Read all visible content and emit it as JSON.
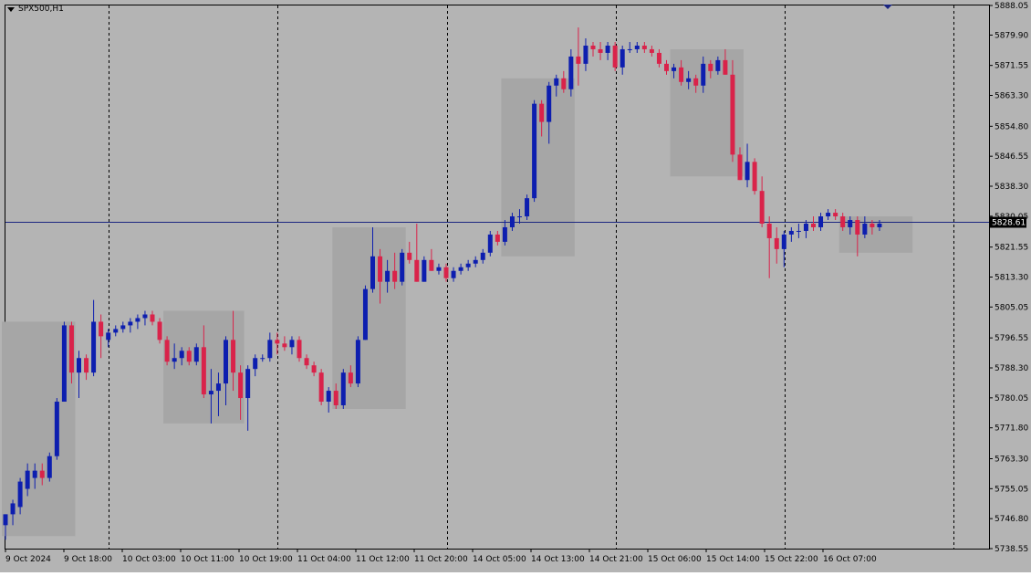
{
  "header": {
    "symbol_timeframe": "SPX500,H1"
  },
  "price_label": "5828.61",
  "colors": {
    "background": "#b4b4b4",
    "zone": "#a6a6a6",
    "bull": "#0d1eaf",
    "bear": "#d9234a",
    "grid": "#000000",
    "price_line": "#1a2580"
  },
  "chart_data": {
    "type": "candlestick",
    "ylim": [
      5738.55,
      5888.05
    ],
    "y_ticks": [
      "5888.05",
      "5879.90",
      "5871.55",
      "5863.30",
      "5854.80",
      "5846.55",
      "5838.30",
      "5830.05",
      "5821.55",
      "5813.30",
      "5805.05",
      "5796.55",
      "5788.30",
      "5780.05",
      "5771.80",
      "5763.30",
      "5755.05",
      "5746.80",
      "5738.55"
    ],
    "x_labels": [
      "9 Oct 2024",
      "9 Oct 18:00",
      "10 Oct 03:00",
      "10 Oct 11:00",
      "10 Oct 19:00",
      "11 Oct 04:00",
      "11 Oct 12:00",
      "11 Oct 20:00",
      "14 Oct 05:00",
      "14 Oct 13:00",
      "14 Oct 21:00",
      "15 Oct 06:00",
      "15 Oct 14:00",
      "15 Oct 22:00",
      "16 Oct 07:00"
    ],
    "current_price": 5828.61,
    "candles": [
      {
        "o": 5745,
        "h": 5748,
        "l": 5741,
        "c": 5748
      },
      {
        "o": 5748,
        "h": 5752,
        "l": 5745,
        "c": 5751
      },
      {
        "o": 5750,
        "h": 5758,
        "l": 5748,
        "c": 5757
      },
      {
        "o": 5755,
        "h": 5762,
        "l": 5753,
        "c": 5760
      },
      {
        "o": 5758,
        "h": 5762,
        "l": 5755,
        "c": 5760
      },
      {
        "o": 5760,
        "h": 5762,
        "l": 5756,
        "c": 5758
      },
      {
        "o": 5758,
        "h": 5765,
        "l": 5757,
        "c": 5764
      },
      {
        "o": 5764,
        "h": 5780,
        "l": 5763,
        "c": 5779
      },
      {
        "o": 5779,
        "h": 5801,
        "l": 5779,
        "c": 5800
      },
      {
        "o": 5800,
        "h": 5801,
        "l": 5784,
        "c": 5787
      },
      {
        "o": 5787,
        "h": 5793,
        "l": 5780,
        "c": 5791
      },
      {
        "o": 5791,
        "h": 5792,
        "l": 5785,
        "c": 5787
      },
      {
        "o": 5787,
        "h": 5807,
        "l": 5786,
        "c": 5801
      },
      {
        "o": 5801,
        "h": 5803,
        "l": 5791,
        "c": 5797
      },
      {
        "o": 5796,
        "h": 5799,
        "l": 5794,
        "c": 5798
      },
      {
        "o": 5798,
        "h": 5800,
        "l": 5797,
        "c": 5799
      },
      {
        "o": 5799,
        "h": 5801,
        "l": 5798,
        "c": 5800
      },
      {
        "o": 5800,
        "h": 5802,
        "l": 5798,
        "c": 5801
      },
      {
        "o": 5801,
        "h": 5803,
        "l": 5799,
        "c": 5802
      },
      {
        "o": 5802,
        "h": 5804,
        "l": 5800,
        "c": 5803
      },
      {
        "o": 5803,
        "h": 5804,
        "l": 5800,
        "c": 5801
      },
      {
        "o": 5801,
        "h": 5802,
        "l": 5795,
        "c": 5796
      },
      {
        "o": 5796,
        "h": 5797,
        "l": 5789,
        "c": 5790
      },
      {
        "o": 5790,
        "h": 5795,
        "l": 5788,
        "c": 5791
      },
      {
        "o": 5791,
        "h": 5794,
        "l": 5789,
        "c": 5793
      },
      {
        "o": 5793,
        "h": 5794,
        "l": 5789,
        "c": 5790
      },
      {
        "o": 5790,
        "h": 5795,
        "l": 5789,
        "c": 5794
      },
      {
        "o": 5794,
        "h": 5800,
        "l": 5780,
        "c": 5781
      },
      {
        "o": 5781,
        "h": 5788,
        "l": 5773,
        "c": 5782
      },
      {
        "o": 5782,
        "h": 5787,
        "l": 5775,
        "c": 5784
      },
      {
        "o": 5784,
        "h": 5797,
        "l": 5778,
        "c": 5796
      },
      {
        "o": 5796,
        "h": 5804,
        "l": 5782,
        "c": 5787
      },
      {
        "o": 5787,
        "h": 5789,
        "l": 5774,
        "c": 5780
      },
      {
        "o": 5780,
        "h": 5789,
        "l": 5771,
        "c": 5788
      },
      {
        "o": 5788,
        "h": 5792,
        "l": 5786,
        "c": 5791
      },
      {
        "o": 5791,
        "h": 5792,
        "l": 5790,
        "c": 5791
      },
      {
        "o": 5791,
        "h": 5798,
        "l": 5790,
        "c": 5796
      },
      {
        "o": 5796,
        "h": 5798,
        "l": 5792,
        "c": 5795
      },
      {
        "o": 5795,
        "h": 5797,
        "l": 5793,
        "c": 5794
      },
      {
        "o": 5794,
        "h": 5797,
        "l": 5792,
        "c": 5796
      },
      {
        "o": 5796,
        "h": 5797,
        "l": 5790,
        "c": 5791
      },
      {
        "o": 5791,
        "h": 5792,
        "l": 5788,
        "c": 5789
      },
      {
        "o": 5789,
        "h": 5790,
        "l": 5786,
        "c": 5787
      },
      {
        "o": 5787,
        "h": 5788,
        "l": 5778,
        "c": 5779
      },
      {
        "o": 5779,
        "h": 5783,
        "l": 5776,
        "c": 5782
      },
      {
        "o": 5782,
        "h": 5784,
        "l": 5777,
        "c": 5778
      },
      {
        "o": 5778,
        "h": 5788,
        "l": 5777,
        "c": 5787
      },
      {
        "o": 5787,
        "h": 5789,
        "l": 5783,
        "c": 5784
      },
      {
        "o": 5784,
        "h": 5797,
        "l": 5783,
        "c": 5796
      },
      {
        "o": 5796,
        "h": 5811,
        "l": 5796,
        "c": 5810
      },
      {
        "o": 5810,
        "h": 5827,
        "l": 5809,
        "c": 5819
      },
      {
        "o": 5819,
        "h": 5821,
        "l": 5806,
        "c": 5812
      },
      {
        "o": 5812,
        "h": 5818,
        "l": 5809,
        "c": 5815
      },
      {
        "o": 5815,
        "h": 5820,
        "l": 5810,
        "c": 5812
      },
      {
        "o": 5812,
        "h": 5821,
        "l": 5811,
        "c": 5820
      },
      {
        "o": 5820,
        "h": 5823,
        "l": 5817,
        "c": 5818
      },
      {
        "o": 5818,
        "h": 5828,
        "l": 5812,
        "c": 5812
      },
      {
        "o": 5812,
        "h": 5819,
        "l": 5812,
        "c": 5818
      },
      {
        "o": 5818,
        "h": 5821,
        "l": 5815,
        "c": 5815
      },
      {
        "o": 5815,
        "h": 5817,
        "l": 5814,
        "c": 5816
      },
      {
        "o": 5816,
        "h": 5817,
        "l": 5812,
        "c": 5813
      },
      {
        "o": 5813,
        "h": 5816,
        "l": 5812,
        "c": 5815
      },
      {
        "o": 5815,
        "h": 5817,
        "l": 5814,
        "c": 5816
      },
      {
        "o": 5816,
        "h": 5818,
        "l": 5815,
        "c": 5817
      },
      {
        "o": 5817,
        "h": 5819,
        "l": 5816,
        "c": 5818
      },
      {
        "o": 5818,
        "h": 5821,
        "l": 5817,
        "c": 5820
      },
      {
        "o": 5820,
        "h": 5826,
        "l": 5819,
        "c": 5825
      },
      {
        "o": 5825,
        "h": 5826,
        "l": 5822,
        "c": 5823
      },
      {
        "o": 5823,
        "h": 5829,
        "l": 5822,
        "c": 5827
      },
      {
        "o": 5827,
        "h": 5831,
        "l": 5826,
        "c": 5830
      },
      {
        "o": 5830,
        "h": 5832,
        "l": 5828,
        "c": 5830
      },
      {
        "o": 5830,
        "h": 5836,
        "l": 5829,
        "c": 5835
      },
      {
        "o": 5835,
        "h": 5862,
        "l": 5834,
        "c": 5861
      },
      {
        "o": 5861,
        "h": 5862,
        "l": 5852,
        "c": 5856
      },
      {
        "o": 5856,
        "h": 5867,
        "l": 5850,
        "c": 5866
      },
      {
        "o": 5866,
        "h": 5869,
        "l": 5863,
        "c": 5868
      },
      {
        "o": 5868,
        "h": 5870,
        "l": 5864,
        "c": 5865
      },
      {
        "o": 5865,
        "h": 5876,
        "l": 5863,
        "c": 5874
      },
      {
        "o": 5874,
        "h": 5882,
        "l": 5866,
        "c": 5872
      },
      {
        "o": 5872,
        "h": 5879,
        "l": 5870,
        "c": 5877
      },
      {
        "o": 5877,
        "h": 5878,
        "l": 5874,
        "c": 5876
      },
      {
        "o": 5876,
        "h": 5878,
        "l": 5873,
        "c": 5875
      },
      {
        "o": 5875,
        "h": 5878,
        "l": 5873,
        "c": 5877
      },
      {
        "o": 5877,
        "h": 5878,
        "l": 5870,
        "c": 5871
      },
      {
        "o": 5871,
        "h": 5877,
        "l": 5869,
        "c": 5876
      },
      {
        "o": 5876,
        "h": 5878,
        "l": 5875,
        "c": 5876
      },
      {
        "o": 5876,
        "h": 5878,
        "l": 5875,
        "c": 5877
      },
      {
        "o": 5877,
        "h": 5878,
        "l": 5875,
        "c": 5876
      },
      {
        "o": 5876,
        "h": 5877,
        "l": 5874,
        "c": 5875
      },
      {
        "o": 5875,
        "h": 5876,
        "l": 5871,
        "c": 5872
      },
      {
        "o": 5872,
        "h": 5873,
        "l": 5869,
        "c": 5870
      },
      {
        "o": 5870,
        "h": 5872,
        "l": 5868,
        "c": 5871
      },
      {
        "o": 5871,
        "h": 5873,
        "l": 5866,
        "c": 5867
      },
      {
        "o": 5867,
        "h": 5870,
        "l": 5865,
        "c": 5868
      },
      {
        "o": 5868,
        "h": 5869,
        "l": 5864,
        "c": 5866
      },
      {
        "o": 5866,
        "h": 5874,
        "l": 5864,
        "c": 5872
      },
      {
        "o": 5872,
        "h": 5873,
        "l": 5868,
        "c": 5870
      },
      {
        "o": 5870,
        "h": 5874,
        "l": 5869,
        "c": 5873
      },
      {
        "o": 5873,
        "h": 5876,
        "l": 5869,
        "c": 5869
      },
      {
        "o": 5869,
        "h": 5873,
        "l": 5845,
        "c": 5847
      },
      {
        "o": 5847,
        "h": 5849,
        "l": 5840,
        "c": 5840
      },
      {
        "o": 5840,
        "h": 5850,
        "l": 5838,
        "c": 5845
      },
      {
        "o": 5845,
        "h": 5846,
        "l": 5836,
        "c": 5837
      },
      {
        "o": 5837,
        "h": 5841,
        "l": 5827,
        "c": 5828
      },
      {
        "o": 5828,
        "h": 5830,
        "l": 5813,
        "c": 5824
      },
      {
        "o": 5824,
        "h": 5827,
        "l": 5817,
        "c": 5821
      },
      {
        "o": 5821,
        "h": 5826,
        "l": 5816,
        "c": 5825
      },
      {
        "o": 5825,
        "h": 5827,
        "l": 5823,
        "c": 5826
      },
      {
        "o": 5826,
        "h": 5828,
        "l": 5824,
        "c": 5826
      },
      {
        "o": 5826,
        "h": 5829,
        "l": 5824,
        "c": 5828
      },
      {
        "o": 5828,
        "h": 5830,
        "l": 5826,
        "c": 5827
      },
      {
        "o": 5827,
        "h": 5831,
        "l": 5826,
        "c": 5830
      },
      {
        "o": 5830,
        "h": 5832,
        "l": 5829,
        "c": 5831
      },
      {
        "o": 5831,
        "h": 5832,
        "l": 5829,
        "c": 5830
      },
      {
        "o": 5830,
        "h": 5831,
        "l": 5826,
        "c": 5827
      },
      {
        "o": 5827,
        "h": 5830,
        "l": 5825,
        "c": 5829
      },
      {
        "o": 5829,
        "h": 5830,
        "l": 5819,
        "c": 5825
      },
      {
        "o": 5825,
        "h": 5830,
        "l": 5824,
        "c": 5828
      },
      {
        "o": 5828,
        "h": 5829,
        "l": 5825,
        "c": 5827
      },
      {
        "o": 5827,
        "h": 5829,
        "l": 5826,
        "c": 5828
      }
    ],
    "zones": [
      {
        "start": 0,
        "end": 9,
        "high": 5801,
        "low": 5742
      },
      {
        "start": 22,
        "end": 32,
        "high": 5804,
        "low": 5773
      },
      {
        "start": 45,
        "end": 54,
        "high": 5827,
        "low": 5777
      },
      {
        "start": 68,
        "end": 77,
        "high": 5868,
        "low": 5819
      },
      {
        "start": 91,
        "end": 100,
        "high": 5876,
        "low": 5841
      },
      {
        "start": 114,
        "end": 123,
        "high": 5830,
        "low": 5820
      }
    ]
  }
}
